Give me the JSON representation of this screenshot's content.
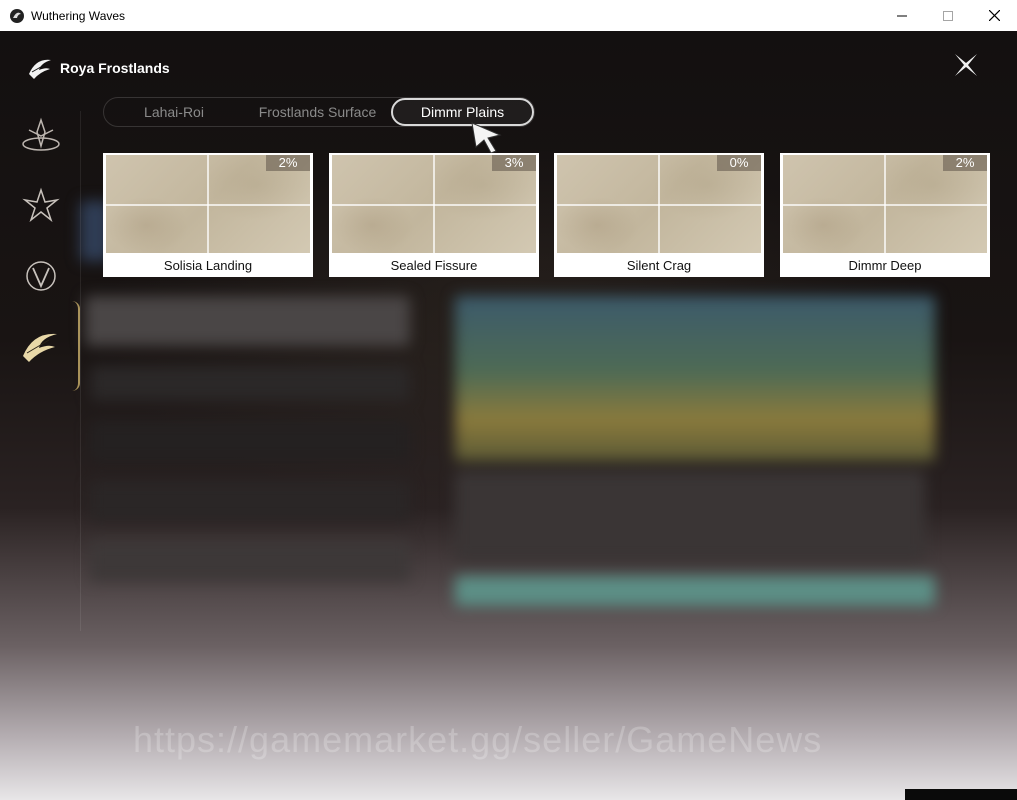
{
  "window": {
    "title": "Wuthering Waves",
    "icons": {
      "app": "wuthering-waves-app-icon",
      "minimize": "minimize-icon",
      "maximize": "maximize-icon",
      "close": "close-icon"
    }
  },
  "region": {
    "title": "Roya Frostlands",
    "emblem": "roya-frostlands-emblem-icon"
  },
  "sidenav": {
    "items": [
      {
        "icon": "region-emblem-1-icon"
      },
      {
        "icon": "region-emblem-2-icon"
      },
      {
        "icon": "region-emblem-3-icon"
      },
      {
        "icon": "roya-frostlands-emblem-icon",
        "active": true
      }
    ]
  },
  "tabs": [
    {
      "label": "Lahai-Roi"
    },
    {
      "label": "Frostlands Surface"
    },
    {
      "label": "Dimmr Plains",
      "selected": true
    }
  ],
  "cards": [
    {
      "name": "Solisia Landing",
      "percent": "2%"
    },
    {
      "name": "Sealed Fissure",
      "percent": "3%"
    },
    {
      "name": "Silent Crag",
      "percent": "0%"
    },
    {
      "name": "Dimmr Deep",
      "percent": "2%"
    }
  ],
  "watermark": "https://gamemarket.gg/seller/GameNews",
  "colors": {
    "accent_gold": "#e6c878",
    "tab_border": "#d9d9d9"
  }
}
